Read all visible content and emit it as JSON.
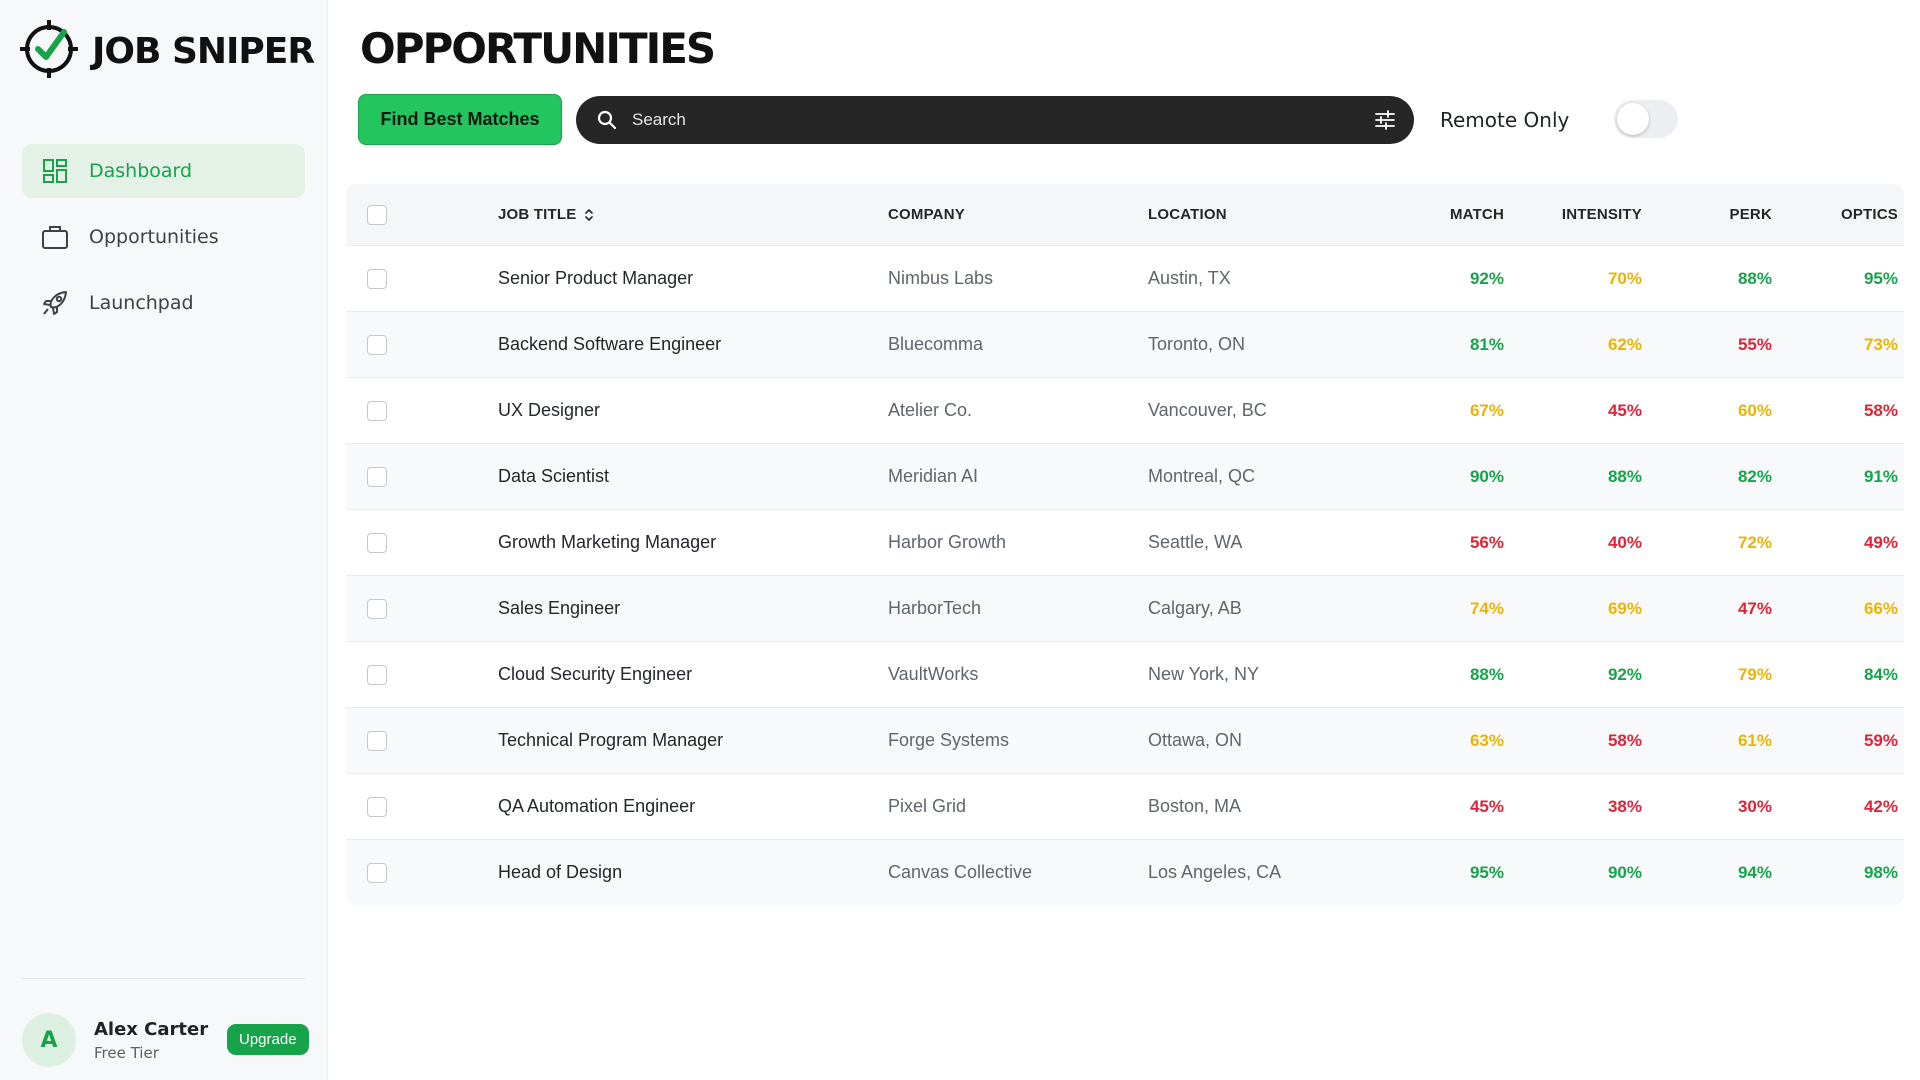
{
  "brand": {
    "name": "JOB SNIPER",
    "logo_icon": "crosshair-check-icon",
    "accent_color": "#16a34a"
  },
  "sidebar": {
    "items": [
      {
        "label": "Dashboard",
        "icon": "dashboard-icon",
        "active": true
      },
      {
        "label": "Opportunities",
        "icon": "briefcase-icon",
        "active": false
      },
      {
        "label": "Launchpad",
        "icon": "rocket-icon",
        "active": false
      }
    ],
    "user": {
      "initial": "A",
      "name": "Alex Carter",
      "tier": "Free Tier",
      "upgrade_label": "Upgrade"
    }
  },
  "page": {
    "title": "OPPORTUNITIES"
  },
  "toolbar": {
    "find_label": "Find Best Matches",
    "search_placeholder": "Search",
    "search_value": "",
    "remote_label": "Remote Only",
    "remote_only": false
  },
  "table": {
    "headers": {
      "title": "JOB TITLE",
      "company": "COMPANY",
      "location": "LOCATION",
      "match": "MATCH",
      "intensity": "INTENSITY",
      "perk": "PERK",
      "optics": "OPTICS"
    },
    "rows": [
      {
        "title": "Senior Product Manager",
        "company": "Nimbus Labs",
        "location": "Austin, TX",
        "match": "92%",
        "intensity": "70%",
        "perk": "88%",
        "optics": "95%"
      },
      {
        "title": "Backend Software Engineer",
        "company": "Bluecomma",
        "location": "Toronto, ON",
        "match": "81%",
        "intensity": "62%",
        "perk": "55%",
        "optics": "73%"
      },
      {
        "title": "UX Designer",
        "company": "Atelier Co.",
        "location": "Vancouver, BC",
        "match": "67%",
        "intensity": "45%",
        "perk": "60%",
        "optics": "58%"
      },
      {
        "title": "Data Scientist",
        "company": "Meridian AI",
        "location": "Montreal, QC",
        "match": "90%",
        "intensity": "88%",
        "perk": "82%",
        "optics": "91%"
      },
      {
        "title": "Growth Marketing Manager",
        "company": "Harbor Growth",
        "location": "Seattle, WA",
        "match": "56%",
        "intensity": "40%",
        "perk": "72%",
        "optics": "49%"
      },
      {
        "title": "Sales Engineer",
        "company": "HarborTech",
        "location": "Calgary, AB",
        "match": "74%",
        "intensity": "69%",
        "perk": "47%",
        "optics": "66%"
      },
      {
        "title": "Cloud Security Engineer",
        "company": "VaultWorks",
        "location": "New York, NY",
        "match": "88%",
        "intensity": "92%",
        "perk": "79%",
        "optics": "84%"
      },
      {
        "title": "Technical Program Manager",
        "company": "Forge Systems",
        "location": "Ottawa, ON",
        "match": "63%",
        "intensity": "58%",
        "perk": "61%",
        "optics": "59%"
      },
      {
        "title": "QA Automation Engineer",
        "company": "Pixel Grid",
        "location": "Boston, MA",
        "match": "45%",
        "intensity": "38%",
        "perk": "30%",
        "optics": "42%"
      },
      {
        "title": "Head of Design",
        "company": "Canvas Collective",
        "location": "Los Angeles, CA",
        "match": "95%",
        "intensity": "90%",
        "perk": "94%",
        "optics": "98%"
      }
    ]
  },
  "score_colors": {
    "high": "#16a34a",
    "mid": "#eab308",
    "low": "#dc2638"
  }
}
